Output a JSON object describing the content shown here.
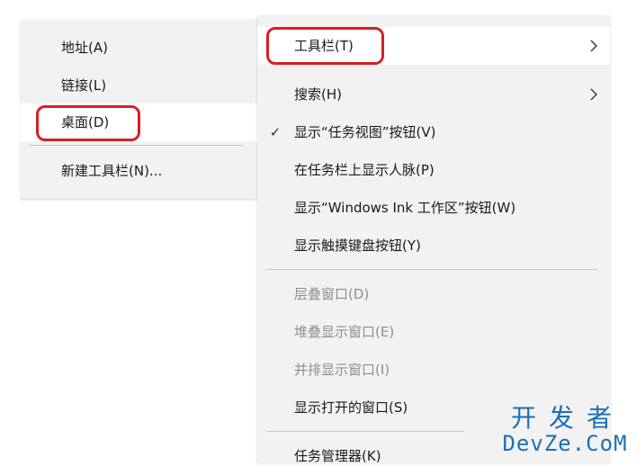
{
  "toolbar_submenu": {
    "items": [
      {
        "label": "地址(A)"
      },
      {
        "label": "链接(L)"
      },
      {
        "label": "桌面(D)"
      },
      {
        "label": "新建工具栏(N)..."
      }
    ]
  },
  "taskbar_menu": {
    "items": [
      {
        "label": "工具栏(T)",
        "has_submenu": true
      },
      {
        "label": "搜索(H)",
        "has_submenu": true
      },
      {
        "label": "显示“任务视图”按钮(V)",
        "checked": true
      },
      {
        "label": "在任务栏上显示人脉(P)"
      },
      {
        "label": "显示“Windows Ink 工作区”按钮(W)"
      },
      {
        "label": "显示触摸键盘按钮(Y)"
      },
      {
        "label": "层叠窗口(D)",
        "disabled": true
      },
      {
        "label": "堆叠显示窗口(E)",
        "disabled": true
      },
      {
        "label": "并排显示窗口(I)",
        "disabled": true
      },
      {
        "label": "显示打开的窗口(S)"
      },
      {
        "label": "任务管理器(K)"
      }
    ],
    "check_glyph": "✓"
  },
  "watermark": {
    "chinese": "开发者",
    "english": "DevZe.CoM"
  },
  "colors": {
    "menu_background": "#f2f2f2",
    "highlight_background": "#ffffff",
    "annotation_red": "#d61f26",
    "watermark_blue": "#1c6fb3",
    "disabled_text": "#8e8e8e"
  }
}
